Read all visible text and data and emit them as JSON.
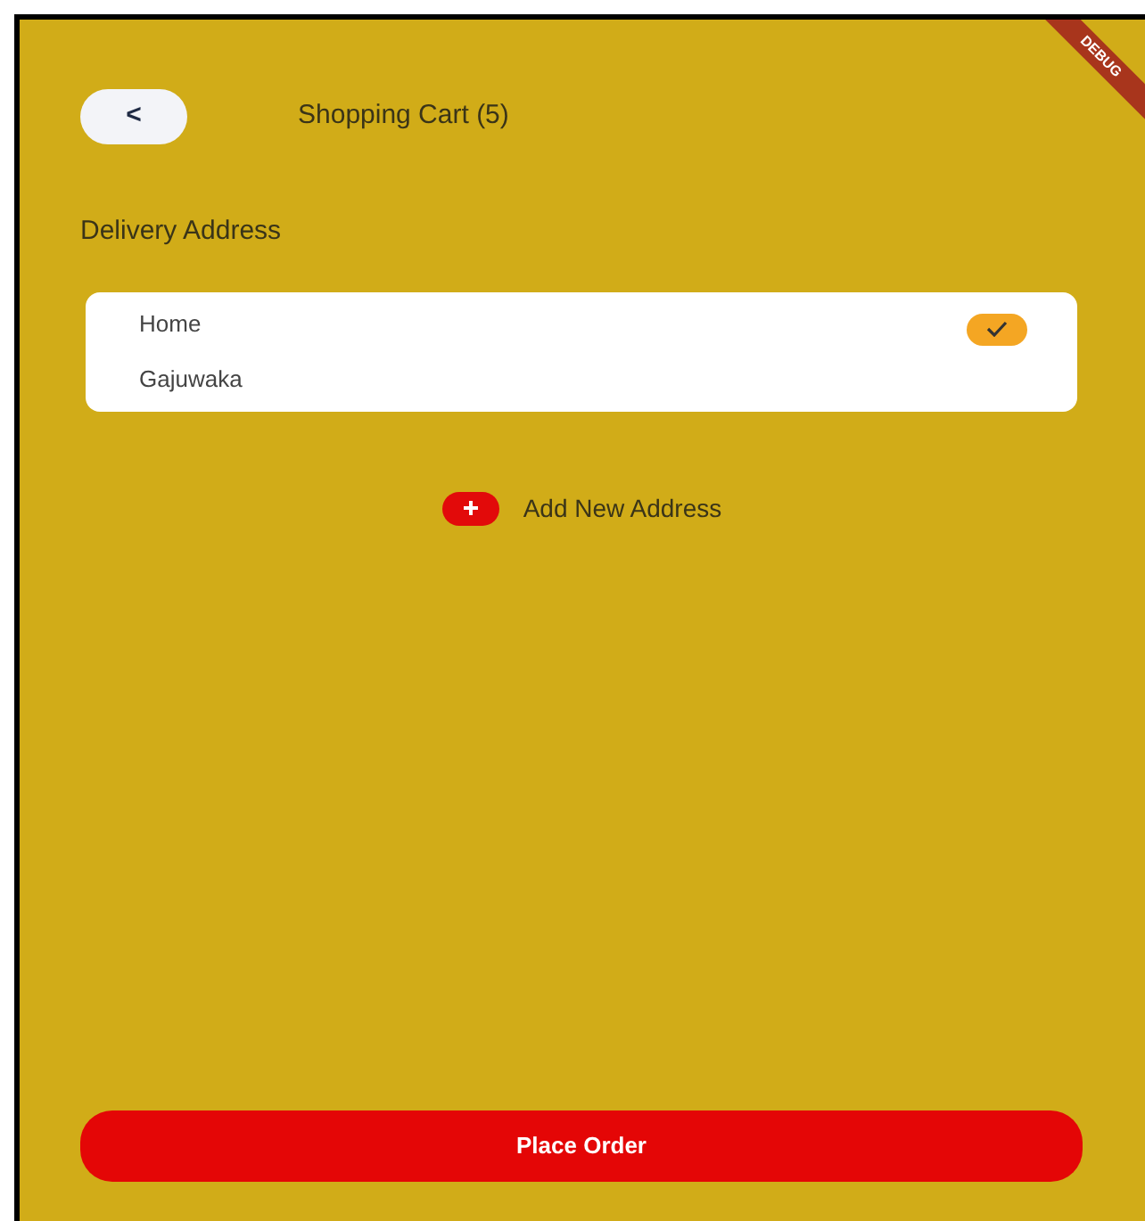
{
  "debug_banner": "DEBUG",
  "header": {
    "back": "<",
    "title": "Shopping Cart (5)"
  },
  "section_title": "Delivery Address",
  "addresses": [
    {
      "label": "Home",
      "area": "Gajuwaka",
      "selected": true
    }
  ],
  "add_address": "Add New Address",
  "place_order": "Place Order"
}
